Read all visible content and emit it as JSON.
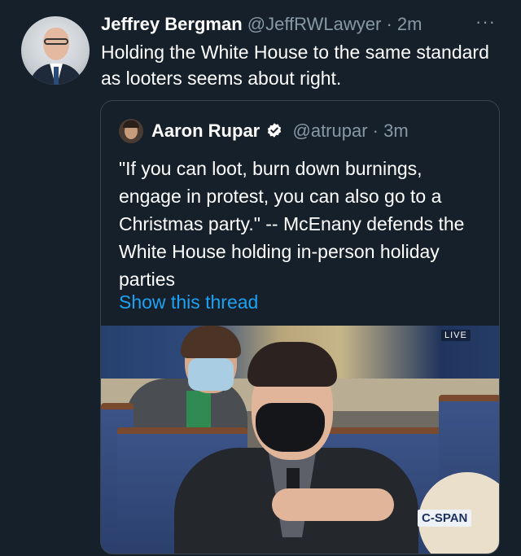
{
  "tweet": {
    "author_name": "Jeffrey Bergman",
    "author_handle": "@JeffRWLawyer",
    "time": "· 2m",
    "more_icon": "more-horizontal-icon",
    "text": "Holding the White House to the same standard as looters seems about right."
  },
  "quoted_tweet": {
    "author_name": "Aaron Rupar",
    "verified_icon": "verified-badge-icon",
    "author_handle": "@atrupar",
    "time": "· 3m",
    "text": "\"If you can loot, burn down burnings, engage in protest, you can also go to a Christmas party.\" -- McEnany defends the White House holding in-person holiday parties",
    "show_thread": "Show this thread"
  },
  "media": {
    "live_label": "LIVE",
    "network_label": "C-SPAN"
  },
  "colors": {
    "background": "#15202b",
    "text_primary": "#ffffff",
    "text_secondary": "#8899a6",
    "link": "#1da1f2",
    "border": "#38444d"
  }
}
